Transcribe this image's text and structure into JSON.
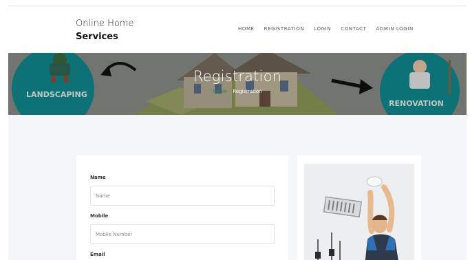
{
  "brand": {
    "line1": "Online Home",
    "line2": "Services"
  },
  "nav": [
    {
      "label": "HOME"
    },
    {
      "label": "REGISTRATION"
    },
    {
      "label": "LOGIN"
    },
    {
      "label": "CONTACT"
    },
    {
      "label": "ADMIN LOGIN"
    }
  ],
  "banner": {
    "title": "Registration",
    "breadcrumb": {
      "home": "Home",
      "current": "Registration"
    },
    "left_sign": "LANDSCAPING",
    "right_sign": "RENOVATION"
  },
  "form": {
    "fields": [
      {
        "label": "Name",
        "placeholder": "Name"
      },
      {
        "label": "Mobile",
        "placeholder": "Mobile Number"
      },
      {
        "label": "Email"
      }
    ]
  },
  "colors": {
    "breadcrumb_home": "#2f8f3f",
    "page_bg": "#f5f6f9",
    "sign_teal": "#0f8b8f"
  }
}
